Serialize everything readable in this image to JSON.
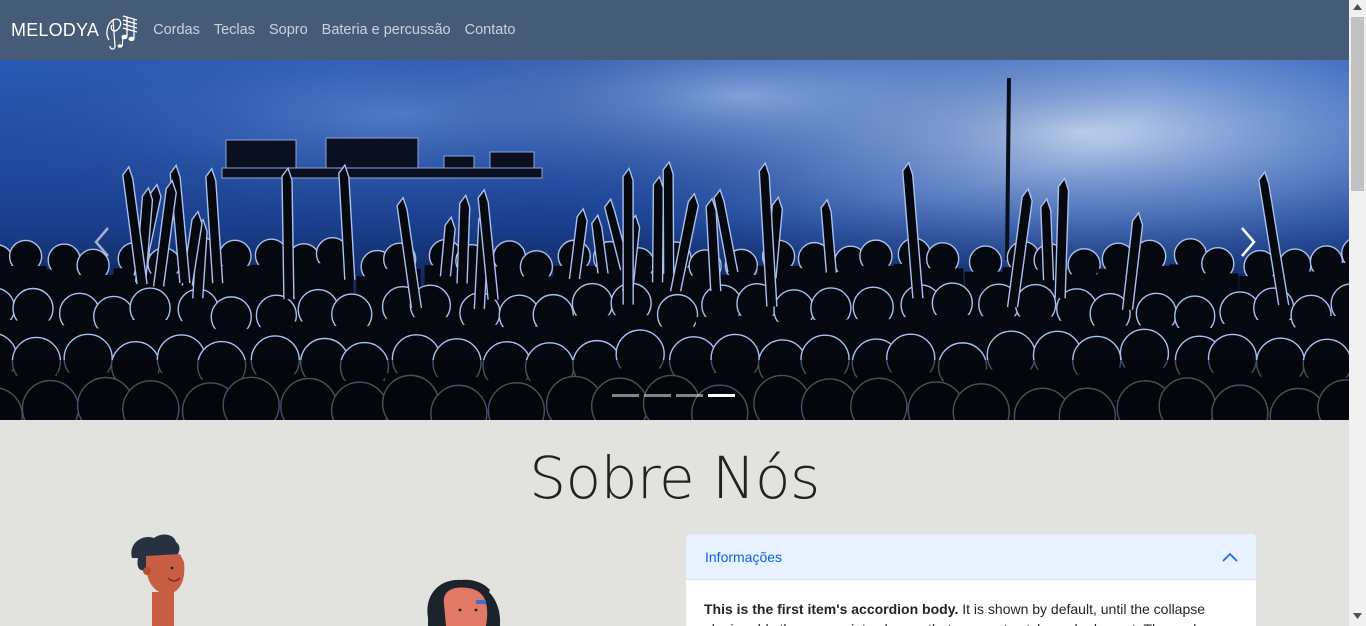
{
  "navbar": {
    "brand": "MELODYA",
    "links": [
      "Cordas",
      "Teclas",
      "Sopro",
      "Bateria e percussão",
      "Contato"
    ]
  },
  "carousel": {
    "indicator_count": 4,
    "active_index": 3
  },
  "about": {
    "title": "Sobre Nós"
  },
  "accordion": {
    "header": "Informações",
    "body_bold": "This is the first item's accordion body.",
    "body_text": " It is shown by default, until the collapse plugin adds the appropriate classes that we use to style each element. These classes"
  },
  "colors": {
    "navbar": "#455b78",
    "page_bg": "#e2e2de",
    "accordion_header_bg": "#e7f1ff",
    "accordion_header_text": "#0c63e4"
  }
}
